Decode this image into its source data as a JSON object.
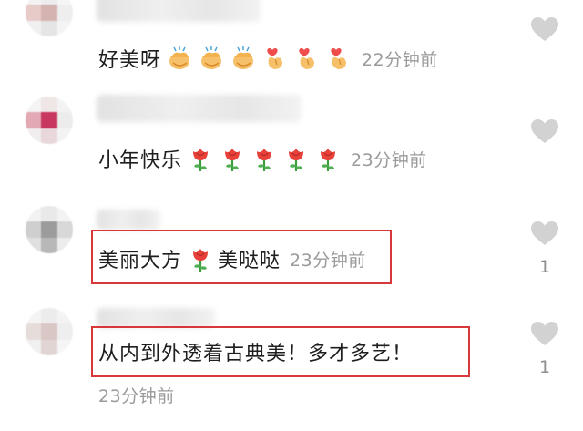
{
  "comments": [
    {
      "text": "好美呀",
      "emojis": [
        "clap-emoji",
        "clap-emoji",
        "clap-emoji",
        "finger-heart-emoji",
        "finger-heart-emoji",
        "finger-heart-emoji"
      ],
      "time": "22分钟前",
      "likes": ""
    },
    {
      "text": "小年快乐",
      "emojis": [
        "rose-emoji",
        "rose-emoji",
        "rose-emoji",
        "rose-emoji",
        "rose-emoji"
      ],
      "time": "23分钟前",
      "likes": ""
    },
    {
      "text_before": "美丽大方",
      "emoji": "rose-emoji",
      "text_after": "美哒哒",
      "time": "23分钟前",
      "likes": "1"
    },
    {
      "text": "从内到外透着古典美！多才多艺！",
      "time": "23分钟前",
      "likes": "1"
    }
  ],
  "colors": {
    "highlight": "#d9383a",
    "heart": "#cfcfcf",
    "time": "#9a9a9a",
    "text": "#1e1e1e"
  }
}
